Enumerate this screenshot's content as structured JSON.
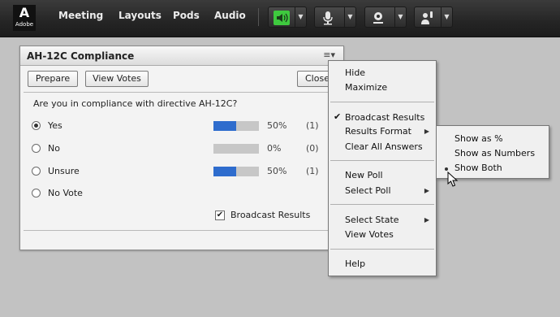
{
  "logo": {
    "mark": "A",
    "word": "Adobe"
  },
  "topbar": {
    "menus": [
      "Meeting",
      "Layouts",
      "Pods",
      "Audio"
    ],
    "icons": [
      "speaker-icon",
      "microphone-icon",
      "webcam-icon",
      "raise-hand-icon"
    ],
    "speaker_color": "#3ec93e"
  },
  "pod": {
    "title": "AH-12C Compliance",
    "prepare_label": "Prepare",
    "view_votes_label": "View Votes",
    "close_label": "Close",
    "question": "Are you in compliance with directive AH-12C?",
    "answers": [
      {
        "label": "Yes",
        "percent": "50%",
        "count": "(1)",
        "fraction": 0.5,
        "selected": true
      },
      {
        "label": "No",
        "percent": "0%",
        "count": "(0)",
        "fraction": 0.0,
        "selected": false
      },
      {
        "label": "Unsure",
        "percent": "50%",
        "count": "(1)",
        "fraction": 0.5,
        "selected": false
      },
      {
        "label": "No Vote"
      }
    ],
    "broadcast_label": "Broadcast Results",
    "broadcast_checked": true,
    "bar_color": "#2e6ccd"
  },
  "menu": {
    "hide": "Hide",
    "maximize": "Maximize",
    "broadcast_results": "Broadcast Results",
    "results_format": "Results Format",
    "clear_all": "Clear All Answers",
    "new_poll": "New Poll",
    "select_poll": "Select Poll",
    "select_state": "Select State",
    "view_votes": "View Votes",
    "help": "Help"
  },
  "submenu": {
    "show_percent": "Show as %",
    "show_numbers": "Show as Numbers",
    "show_both": "Show Both",
    "selected": "Show Both"
  }
}
